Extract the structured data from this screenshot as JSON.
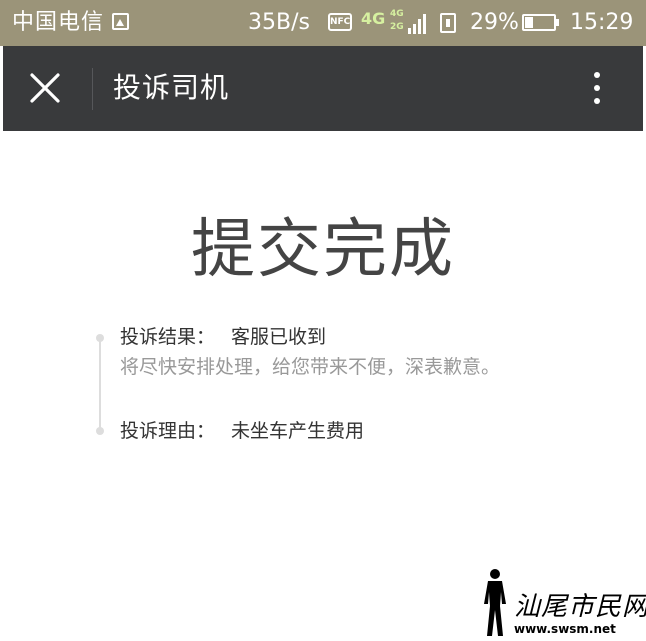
{
  "status_bar": {
    "carrier": "中国电信",
    "gallery_icon": "image-icon",
    "speed": "35B/s",
    "nfc_label": "NFC",
    "network_main": "4G",
    "network_stack_top": "4G",
    "network_stack_bottom": "2G",
    "signal_icon": "signal-bars-icon",
    "sim_icon": "sim-card-icon",
    "battery_percent": "29%",
    "battery_level": 0.29,
    "time": "15:29"
  },
  "nav_bar": {
    "close_icon": "close-icon",
    "title": "投诉司机",
    "more_icon": "more-vertical-icon",
    "background": "#393a3c"
  },
  "main": {
    "headline": "提交完成",
    "timeline": [
      {
        "label": "投诉结果：",
        "value": "客服已收到",
        "note": "将尽快安排处理，给您带来不便，深表歉意。"
      },
      {
        "label": "投诉理由：",
        "value": "未坐车产生费用"
      }
    ]
  },
  "watermark": {
    "brand": "汕尾市民网",
    "url": "www.swsm.net"
  },
  "colors": {
    "status_bar": "#9b9479",
    "nav_bar": "#393a3c",
    "headline": "#444444",
    "secondary_text": "#999999"
  }
}
